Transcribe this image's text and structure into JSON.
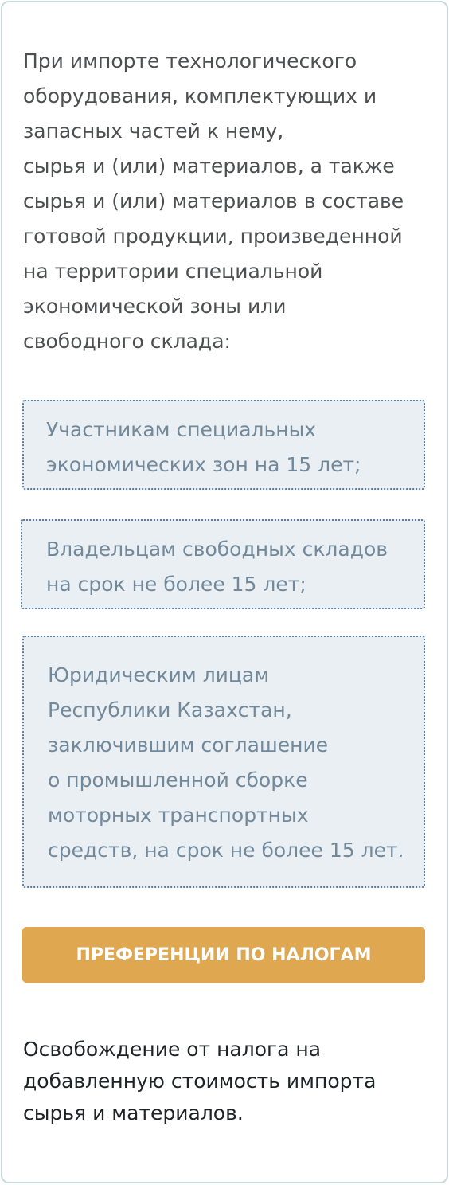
{
  "intro": {
    "lines": [
      "При импорте технологического",
      "оборудования, комплектующих и",
      "запасных частей к нему,",
      "сырья и (или) материалов, а также",
      "сырья и (или) материалов в составе",
      "готовой продукции, произведенной",
      "на территории специальной",
      "экономической зоны или",
      "свободного склада:"
    ]
  },
  "options": [
    {
      "lines": [
        "Участникам специальных",
        "экономических зон на 15 лет;"
      ]
    },
    {
      "lines": [
        "Владельцам свободных складов",
        "на срок не более 15 лет;"
      ]
    },
    {
      "lines": [
        "Юридическим лицам",
        "Республики Казахстан,",
        "заключившим соглашение",
        "о промышленной сборке",
        "моторных транспортных",
        "средств, на срок не более 15 лет."
      ]
    }
  ],
  "button": {
    "label": "ПРЕФЕРЕНЦИИ ПО НАЛОГАМ"
  },
  "footer": {
    "lines": [
      "Освобождение от налога на",
      "добавленную стоимость импорта",
      "сырья и материалов."
    ]
  },
  "colors": {
    "accent": "#dfa74f",
    "box_background": "#e9eff2",
    "box_border": "#5d7fa1",
    "card_border": "#c9d9dc"
  }
}
